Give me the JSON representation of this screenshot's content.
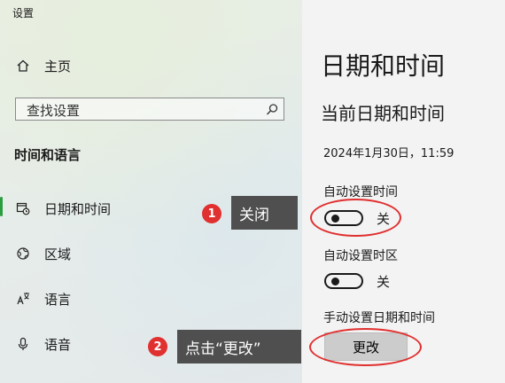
{
  "window": {
    "title": "设置"
  },
  "sidebar": {
    "home": {
      "label": "主页",
      "icon": "home-icon"
    },
    "search": {
      "placeholder": "查找设置",
      "icon": "search-icon"
    },
    "section_title": "时间和语言",
    "items": [
      {
        "label": "日期和时间",
        "icon": "calendar-clock-icon",
        "active": true
      },
      {
        "label": "区域",
        "icon": "globe-icon",
        "active": false
      },
      {
        "label": "语言",
        "icon": "language-icon",
        "active": false
      },
      {
        "label": "语音",
        "icon": "microphone-icon",
        "active": false
      }
    ],
    "accent_color": "#2a9d3f"
  },
  "main": {
    "title": "日期和时间",
    "subtitle": "当前日期和时间",
    "current_datetime": "2024年1月30日，11:59",
    "auto_time": {
      "label": "自动设置时间",
      "state": "关"
    },
    "auto_timezone": {
      "label": "自动设置时区",
      "state": "关"
    },
    "manual": {
      "label": "手动设置日期和时间",
      "button": "更改"
    }
  },
  "annotations": {
    "step1": {
      "number": "1",
      "text": "关闭"
    },
    "step2": {
      "number": "2",
      "text": "点击“更改”"
    },
    "color": "#e0302f"
  }
}
